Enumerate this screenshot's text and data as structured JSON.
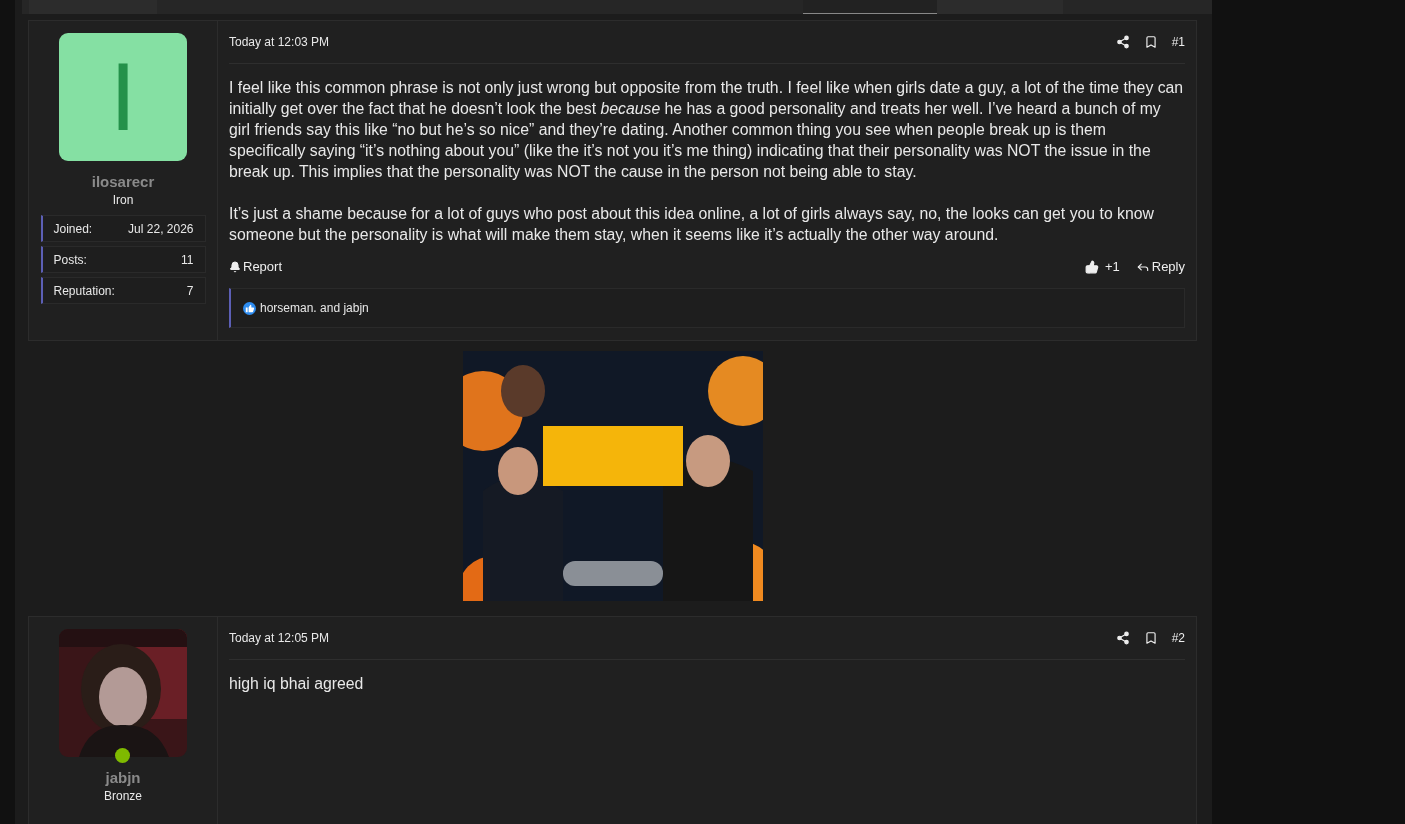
{
  "top_tabs": [
    {
      "selected": false
    },
    {
      "selected": true
    },
    {
      "selected": false
    }
  ],
  "posts": [
    {
      "author": {
        "name": "ilosarecr",
        "rank": "Iron",
        "avatar": {
          "kind": "letter",
          "letter": "I"
        },
        "online": false,
        "stats": [
          {
            "label": "Joined:",
            "value": "Jul 22, 2026"
          },
          {
            "label": "Posts:",
            "value": "11"
          },
          {
            "label": "Reputation:",
            "value": "7"
          }
        ]
      },
      "date": "Today at 12:03 PM",
      "number": "#1",
      "paragraphs": [
        "I feel like this common phrase is not only just wrong but opposite from the truth. I feel like when girls date a guy, a lot of the time they can initially get over the fact that he doesn’t look the best *because* he has a good personality and treats her well. I’ve heard a bunch of my girl friends say this like “no but he’s so nice” and they’re dating. Another common thing you see when people break up is them specifically saying “it’s nothing about you” (like the it’s not you it’s me thing) indicating that their personality was NOT the issue in the break up. This implies that the personality was NOT the cause in the person not being able to stay.",
        "It’s just a shame because for a lot of guys who post about this idea online, a lot of girls always say, no, the looks can get you to know someone but the personality is what will make them stay, when it seems like it’s actually the other way around."
      ],
      "actions": {
        "report": "Report",
        "likes": "+1",
        "reply": "Reply"
      },
      "reactions": "horseman. and jabjn"
    },
    {
      "author": {
        "name": "jabjn",
        "rank": "Bronze",
        "online": true
      },
      "date": "Today at 12:05 PM",
      "number": "#2",
      "paragraphs": [
        "high iq bhai agreed"
      ]
    }
  ]
}
